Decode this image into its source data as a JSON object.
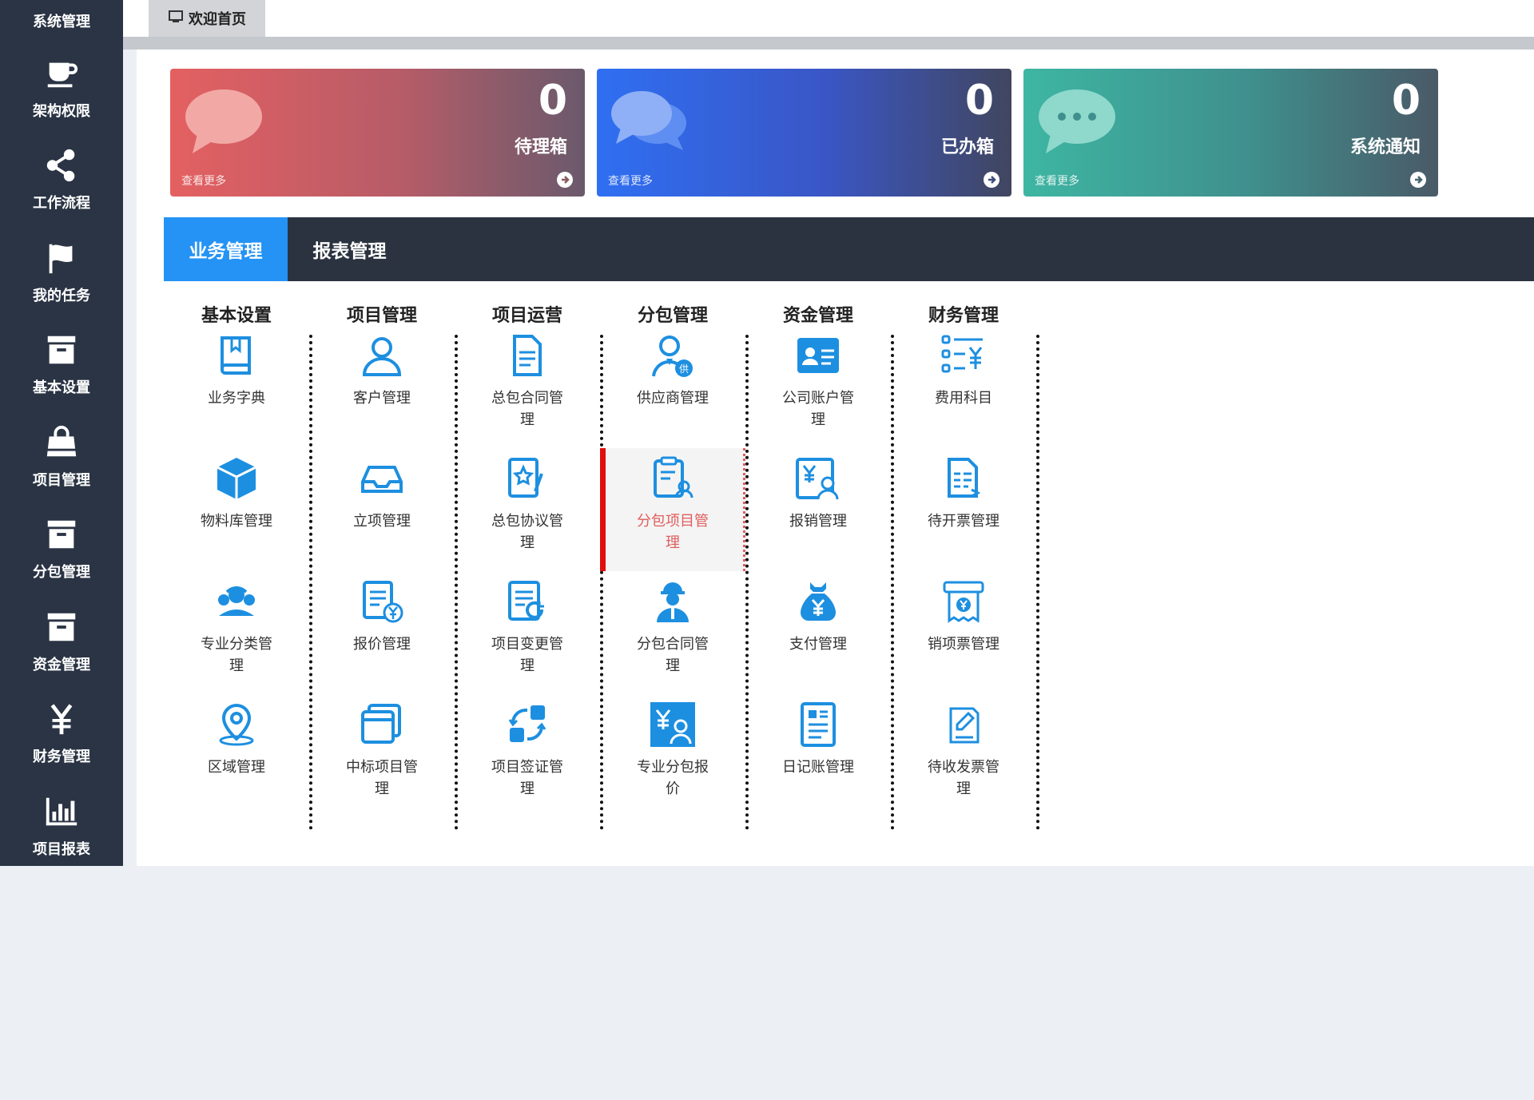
{
  "sidebar": {
    "top_label": "系统管理",
    "items": [
      {
        "label": "架构权限",
        "icon": "coffee-cup-icon"
      },
      {
        "label": "工作流程",
        "icon": "share-icon"
      },
      {
        "label": "我的任务",
        "icon": "flag-icon"
      },
      {
        "label": "基本设置",
        "icon": "archive-box-icon"
      },
      {
        "label": "项目管理",
        "icon": "shopping-bag-icon"
      },
      {
        "label": "分包管理",
        "icon": "archive-box-icon"
      },
      {
        "label": "资金管理",
        "icon": "archive-box-icon"
      },
      {
        "label": "财务管理",
        "icon": "yen-icon"
      },
      {
        "label": "项目报表",
        "icon": "bar-chart-icon"
      }
    ]
  },
  "tabs": {
    "welcome": "欢迎首页"
  },
  "stats": {
    "more_label": "查看更多",
    "cards": [
      {
        "count": "0",
        "label": "待理箱",
        "color": "#e46061"
      },
      {
        "count": "0",
        "label": "已办箱",
        "color": "#2f6ff2"
      },
      {
        "count": "0",
        "label": "系统通知",
        "color": "#3eb6a3"
      }
    ]
  },
  "module_tabs": [
    "业务管理",
    "报表管理"
  ],
  "modules": [
    {
      "title": "基本设置",
      "items": [
        {
          "lines": [
            "业务字典"
          ],
          "icon": "book-icon"
        },
        {
          "lines": [
            "物料库管理"
          ],
          "icon": "cube-icon"
        },
        {
          "lines": [
            "专业分类管",
            "理"
          ],
          "icon": "worker-group-icon"
        },
        {
          "lines": [
            "区域管理"
          ],
          "icon": "location-pin-icon"
        }
      ]
    },
    {
      "title": "项目管理",
      "items": [
        {
          "lines": [
            "客户管理"
          ],
          "icon": "user-icon"
        },
        {
          "lines": [
            "立项管理"
          ],
          "icon": "inbox-icon"
        },
        {
          "lines": [
            "报价管理"
          ],
          "icon": "quote-document-icon"
        },
        {
          "lines": [
            "中标项目管",
            "理"
          ],
          "icon": "window-stack-icon"
        }
      ]
    },
    {
      "title": "项目运营",
      "items": [
        {
          "lines": [
            "总包合同管",
            "理"
          ],
          "icon": "contract-document-icon"
        },
        {
          "lines": [
            "总包协议管",
            "理"
          ],
          "icon": "star-document-icon"
        },
        {
          "lines": [
            "项目变更管",
            "理"
          ],
          "icon": "change-document-icon"
        },
        {
          "lines": [
            "项目签证管",
            "理"
          ],
          "icon": "exchange-arrows-icon"
        }
      ]
    },
    {
      "title": "分包管理",
      "items": [
        {
          "lines": [
            "供应商管理"
          ],
          "icon": "supplier-user-icon"
        },
        {
          "lines": [
            "分包项目管",
            "理"
          ],
          "icon": "clipboard-user-icon",
          "active": true
        },
        {
          "lines": [
            "分包合同管",
            "理"
          ],
          "icon": "construction-worker-icon"
        },
        {
          "lines": [
            "专业分包报",
            "价"
          ],
          "icon": "yen-user-box-icon"
        }
      ]
    },
    {
      "title": "资金管理",
      "items": [
        {
          "lines": [
            "公司账户管",
            "理"
          ],
          "icon": "id-card-icon"
        },
        {
          "lines": [
            "报销管理"
          ],
          "icon": "yen-user-icon"
        },
        {
          "lines": [
            "支付管理"
          ],
          "icon": "money-bag-icon"
        },
        {
          "lines": [
            "日记账管理"
          ],
          "icon": "journal-icon"
        }
      ]
    },
    {
      "title": "财务管理",
      "items": [
        {
          "lines": [
            "费用科目"
          ],
          "icon": "yen-list-icon"
        },
        {
          "lines": [
            "待开票管理"
          ],
          "icon": "invoice-document-icon"
        },
        {
          "lines": [
            "销项票管理"
          ],
          "icon": "receipt-printer-icon"
        },
        {
          "lines": [
            "待收发票管",
            "理"
          ],
          "icon": "pen-note-icon"
        }
      ]
    }
  ]
}
